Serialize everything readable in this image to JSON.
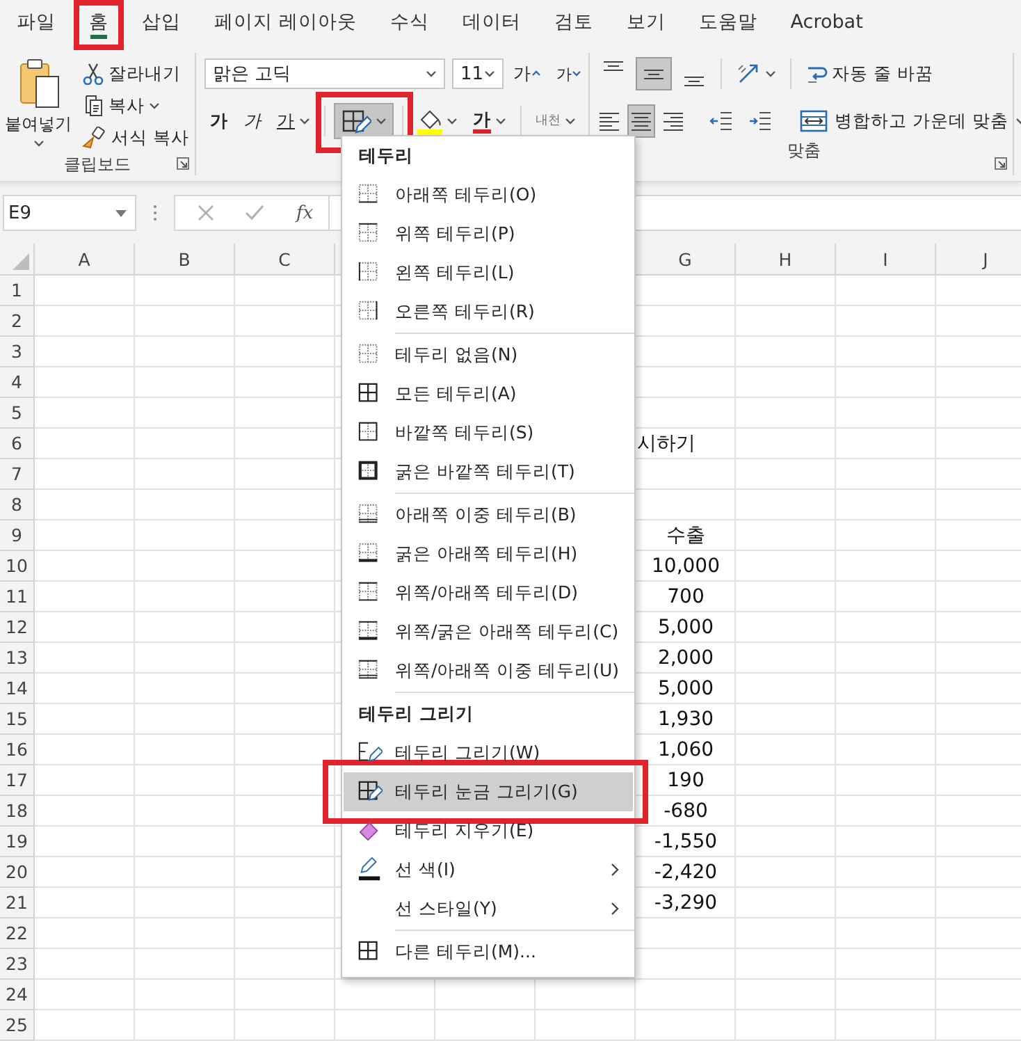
{
  "tabs": [
    {
      "label": "파일",
      "selected": false
    },
    {
      "label": "홈",
      "selected": true,
      "highlighted": true
    },
    {
      "label": "삽입",
      "selected": false
    },
    {
      "label": "페이지 레이아웃",
      "selected": false
    },
    {
      "label": "수식",
      "selected": false
    },
    {
      "label": "데이터",
      "selected": false
    },
    {
      "label": "검토",
      "selected": false
    },
    {
      "label": "보기",
      "selected": false
    },
    {
      "label": "도움말",
      "selected": false
    },
    {
      "label": "Acrobat",
      "selected": false
    }
  ],
  "ribbon": {
    "clipboard": {
      "paste": "붙여넣기",
      "cut": "잘라내기",
      "copy": "복사",
      "format_painter": "서식 복사",
      "group_label": "클립보드"
    },
    "font": {
      "name": "맑은 고딕",
      "size": "11",
      "grow": "가",
      "shrink": "가",
      "bold": "가",
      "italic": "가",
      "underline": "가",
      "border_button": {
        "pressed": true,
        "highlighted": true
      },
      "font_color": "가",
      "phonetic": "내천"
    },
    "alignment": {
      "vertical": [
        {
          "kind": "top",
          "selected": false
        },
        {
          "kind": "middle",
          "selected": true
        },
        {
          "kind": "bottom",
          "selected": false
        }
      ],
      "horizontal": [
        {
          "kind": "left",
          "selected": false
        },
        {
          "kind": "center",
          "selected": true
        },
        {
          "kind": "right",
          "selected": false
        }
      ],
      "wrap_text": "자동 줄 바꿈",
      "merge_center": "병합하고 가운데 맞춤",
      "group_label": "맞춤"
    }
  },
  "formula_bar": {
    "name_box": "E9",
    "function_label": "fx"
  },
  "sheet": {
    "columns": [
      "A",
      "B",
      "C",
      null,
      null,
      null,
      "G",
      "H",
      "I",
      "J"
    ],
    "rows": [
      {
        "header": "1"
      },
      {
        "header": "2"
      },
      {
        "header": "3"
      },
      {
        "header": "4"
      },
      {
        "header": "5"
      },
      {
        "header": "6",
        "cells": [
          null,
          null,
          null,
          null,
          null,
          null,
          {
            "text": "시하기",
            "kind": "overflow"
          }
        ]
      },
      {
        "header": "7"
      },
      {
        "header": "8"
      },
      {
        "header": "9",
        "cells": [
          null,
          null,
          null,
          null,
          null,
          null,
          "수출"
        ]
      },
      {
        "header": "10",
        "cells": [
          null,
          null,
          null,
          null,
          null,
          null,
          "10,000"
        ]
      },
      {
        "header": "11",
        "cells": [
          null,
          null,
          null,
          null,
          null,
          null,
          "700"
        ]
      },
      {
        "header": "12",
        "cells": [
          null,
          null,
          null,
          null,
          null,
          null,
          "5,000"
        ]
      },
      {
        "header": "13",
        "cells": [
          null,
          null,
          null,
          null,
          null,
          null,
          "2,000"
        ]
      },
      {
        "header": "14",
        "cells": [
          null,
          null,
          null,
          null,
          null,
          null,
          "5,000"
        ]
      },
      {
        "header": "15",
        "cells": [
          null,
          null,
          null,
          null,
          null,
          null,
          "1,930"
        ]
      },
      {
        "header": "16",
        "cells": [
          null,
          null,
          null,
          null,
          null,
          null,
          "1,060"
        ]
      },
      {
        "header": "17",
        "cells": [
          null,
          null,
          null,
          null,
          null,
          null,
          "190"
        ]
      },
      {
        "header": "18",
        "cells": [
          null,
          null,
          null,
          null,
          null,
          null,
          "-680"
        ]
      },
      {
        "header": "19",
        "cells": [
          null,
          null,
          null,
          null,
          null,
          null,
          "-1,550"
        ]
      },
      {
        "header": "20",
        "cells": [
          null,
          null,
          null,
          null,
          null,
          null,
          "-2,420"
        ]
      },
      {
        "header": "21",
        "cells": [
          null,
          null,
          null,
          null,
          null,
          null,
          "-3,290"
        ]
      },
      {
        "header": "22"
      },
      {
        "header": "23"
      },
      {
        "header": "24"
      },
      {
        "header": "25"
      }
    ]
  },
  "border_menu": {
    "items": [
      {
        "kind": "header",
        "label": "테두리"
      },
      {
        "kind": "bottom",
        "label": "아래쪽 테두리(O)",
        "selected": false,
        "submenu": false
      },
      {
        "kind": "top",
        "label": "위쪽 테두리(P)",
        "selected": false,
        "submenu": false
      },
      {
        "kind": "left",
        "label": "왼쪽 테두리(L)",
        "selected": false,
        "submenu": false
      },
      {
        "kind": "right",
        "label": "오른쪽 테두리(R)",
        "selected": false,
        "submenu": false
      },
      {
        "kind": "separator"
      },
      {
        "kind": "none",
        "label": "테두리 없음(N)",
        "selected": false,
        "submenu": false
      },
      {
        "kind": "all",
        "label": "모든 테두리(A)",
        "selected": false,
        "submenu": false
      },
      {
        "kind": "outside",
        "label": "바깥쪽 테두리(S)",
        "selected": false,
        "submenu": false
      },
      {
        "kind": "thick-outside",
        "label": "굵은 바깥쪽 테두리(T)",
        "selected": false,
        "submenu": false
      },
      {
        "kind": "separator"
      },
      {
        "kind": "double-bottom",
        "label": "아래쪽 이중 테두리(B)",
        "selected": false,
        "submenu": false
      },
      {
        "kind": "thick-bottom",
        "label": "굵은 아래쪽 테두리(H)",
        "selected": false,
        "submenu": false
      },
      {
        "kind": "top-bottom",
        "label": "위쪽/아래쪽 테두리(D)",
        "selected": false,
        "submenu": false
      },
      {
        "kind": "top-thick-bottom",
        "label": "위쪽/굵은 아래쪽 테두리(C)",
        "selected": false,
        "submenu": false
      },
      {
        "kind": "top-double-bottom",
        "label": "위쪽/아래쪽 이중 테두리(U)",
        "selected": false,
        "submenu": false
      },
      {
        "kind": "separator"
      },
      {
        "kind": "header",
        "label": "테두리 그리기"
      },
      {
        "kind": "draw-border",
        "label": "테두리 그리기(W)",
        "selected": false,
        "submenu": false
      },
      {
        "kind": "draw-grid",
        "label": "테두리 눈금 그리기(G)",
        "selected": true,
        "highlighted": true,
        "submenu": false
      },
      {
        "kind": "eraser",
        "label": "테두리 지우기(E)",
        "selected": false,
        "submenu": false
      },
      {
        "kind": "line-color",
        "label": "선 색(I)",
        "selected": false,
        "submenu": true
      },
      {
        "kind": "line-style",
        "label": "선 스타일(Y)",
        "selected": false,
        "submenu": true
      },
      {
        "kind": "separator"
      },
      {
        "kind": "more",
        "label": "다른 테두리(M)...",
        "selected": false,
        "submenu": false
      }
    ]
  }
}
